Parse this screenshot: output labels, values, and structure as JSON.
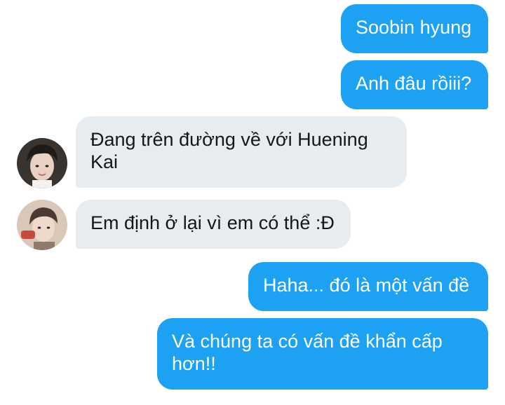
{
  "conversation": {
    "messages": [
      {
        "direction": "sent",
        "text": "Soobin hyung"
      },
      {
        "direction": "sent",
        "text": "Anh đâu rồiii?"
      },
      {
        "direction": "received",
        "avatar": "avatar-1",
        "text": "Đang trên đường về với Huening Kai"
      },
      {
        "direction": "received",
        "avatar": "avatar-2",
        "text": "Em định ở lại vì em có thể :Đ"
      },
      {
        "direction": "sent",
        "text": "Haha... đó là một vấn đề"
      },
      {
        "direction": "sent",
        "text": "Và chúng ta có vấn đề khẩn cấp hơn!!"
      }
    ]
  },
  "colors": {
    "sent_bubble": "#1da1f2",
    "received_bubble": "#e6ecf0",
    "sent_text": "#ffffff",
    "received_text": "#14171a"
  }
}
